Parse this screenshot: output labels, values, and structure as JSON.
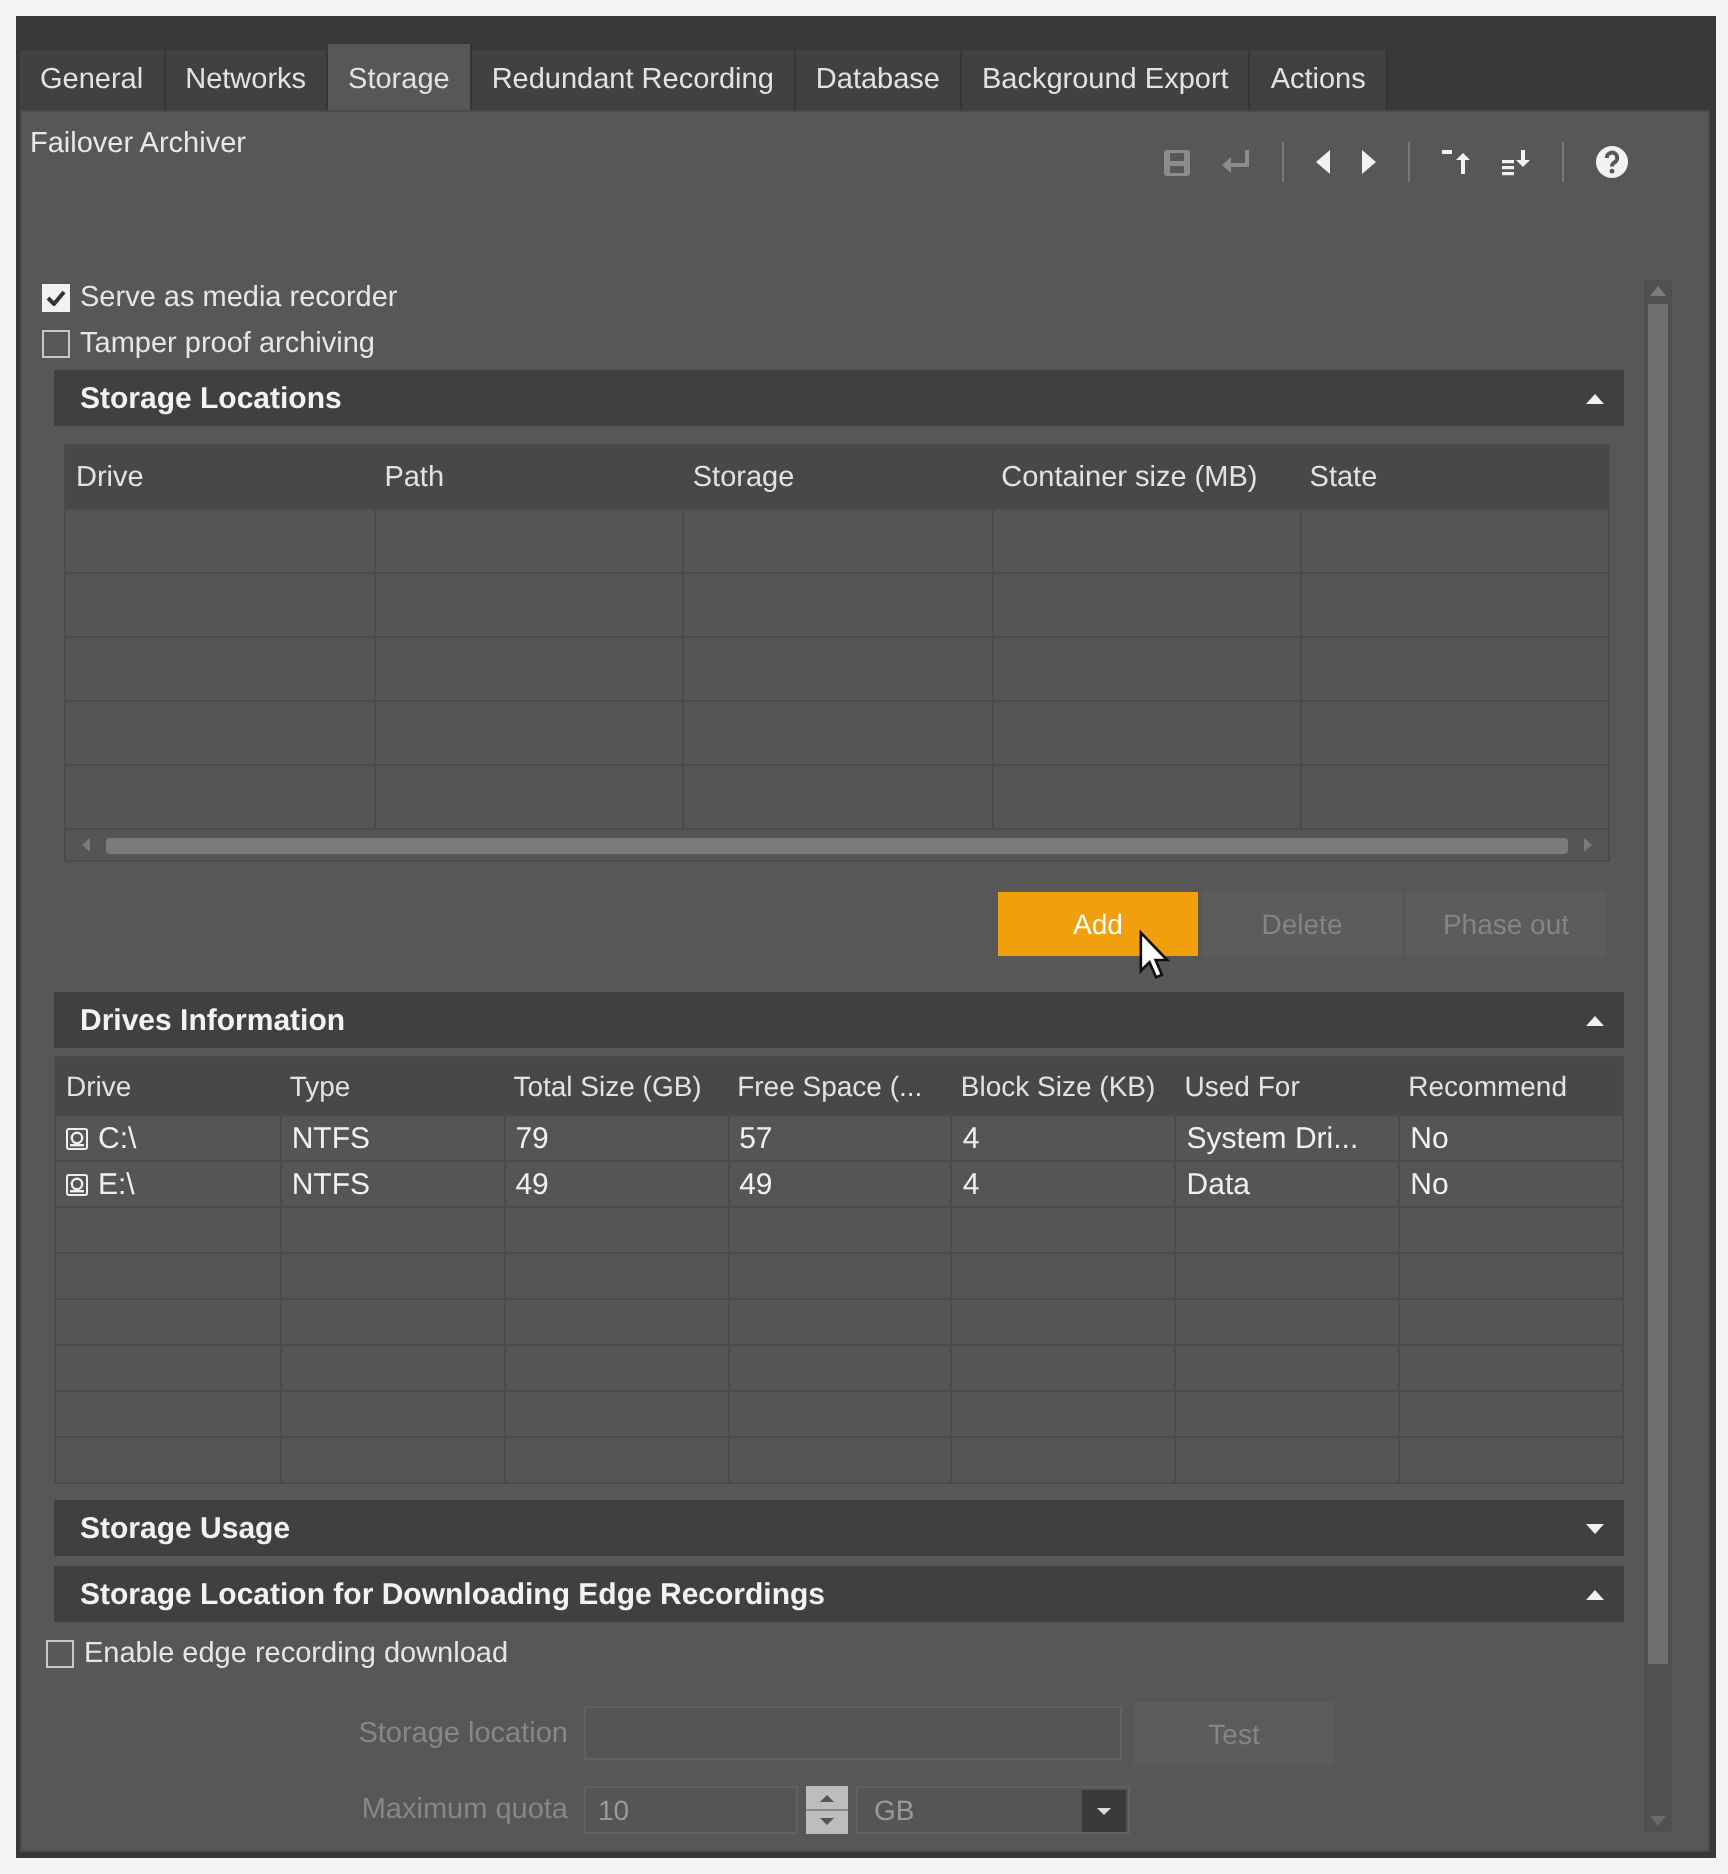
{
  "tabs": [
    {
      "label": "General",
      "selected": false
    },
    {
      "label": "Networks",
      "selected": false
    },
    {
      "label": "Storage",
      "selected": true
    },
    {
      "label": "Redundant Recording",
      "selected": false
    },
    {
      "label": "Database",
      "selected": false
    },
    {
      "label": "Background Export",
      "selected": false
    },
    {
      "label": "Actions",
      "selected": false
    }
  ],
  "panel": {
    "title": "Failover Archiver",
    "toolbar": [
      {
        "kind": "save",
        "disabled": true
      },
      {
        "kind": "undo",
        "disabled": true
      },
      {
        "kind": "separator"
      },
      {
        "kind": "previous",
        "disabled": false
      },
      {
        "kind": "next",
        "disabled": false
      },
      {
        "kind": "separator"
      },
      {
        "kind": "move_up",
        "disabled": false
      },
      {
        "kind": "move_down",
        "disabled": false
      },
      {
        "kind": "separator"
      },
      {
        "kind": "help",
        "disabled": false
      }
    ]
  },
  "checkboxes": [
    {
      "label": "Serve as media recorder",
      "checked": true
    },
    {
      "label": "Tamper proof archiving",
      "checked": false
    }
  ],
  "storage_locations": {
    "title": "Storage Locations",
    "expanded": true,
    "columns": [
      "Drive",
      "Path",
      "Storage",
      "Container size (MB)",
      "State"
    ],
    "buttons": [
      {
        "label": "Add",
        "hovered": true,
        "disabled": false
      },
      {
        "label": "Delete",
        "hovered": false,
        "disabled": true
      },
      {
        "label": "Phase out",
        "hovered": false,
        "disabled": true
      }
    ]
  },
  "drives_information": {
    "title": "Drives Information",
    "expanded": true,
    "columns": [
      "Drive",
      "Type",
      "Total Size (GB)",
      "Free Space (...",
      "Block Size (KB)",
      "Used For",
      "Recommend"
    ],
    "rows": [
      {
        "cells": [
          "C:\\",
          "NTFS",
          "79",
          "57",
          "4",
          "System Dri...",
          "No"
        ]
      },
      {
        "cells": [
          "E:\\",
          "NTFS",
          "49",
          "49",
          "4",
          "Data",
          "No"
        ]
      }
    ]
  },
  "storage_usage": {
    "title": "Storage Usage",
    "expanded": false
  },
  "edge_recordings": {
    "title": "Storage Location for Downloading Edge Recordings",
    "expanded": true,
    "checkbox": {
      "label": "Enable edge recording download",
      "checked": false
    },
    "storage_location": {
      "label": "Storage location",
      "disabled": true
    },
    "test_button": {
      "label": "Test",
      "disabled": true
    },
    "maximum_quota": {
      "label": "Maximum quota",
      "value": "10",
      "unit": "GB",
      "disabled": true
    }
  }
}
